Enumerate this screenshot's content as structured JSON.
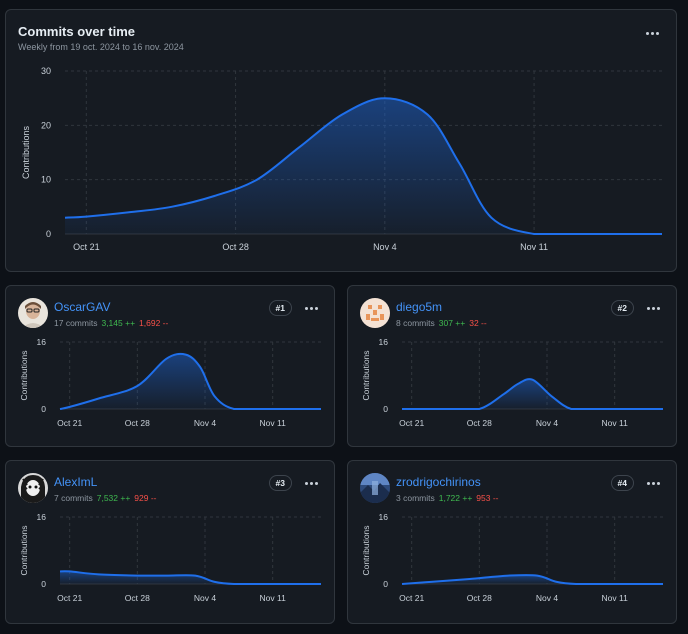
{
  "main": {
    "title": "Commits over time",
    "subtitle": "Weekly from 19 oct. 2024 to 16 nov. 2024"
  },
  "colors": {
    "background": "#0d1117",
    "panel": "#161b22",
    "border": "#30363d",
    "line": "#1f6feb",
    "grid": "#30363d",
    "link": "#4493f8",
    "additions": "#3fb950",
    "deletions": "#f85149"
  },
  "contributors": [
    {
      "rank": "#1",
      "name": "OscarGAV",
      "commits": "17 commits",
      "additions": "3,145 ++",
      "deletions": "1,692 --",
      "avatar": "avatar-photo"
    },
    {
      "rank": "#2",
      "name": "diego5m",
      "commits": "8 commits",
      "additions": "307 ++",
      "deletions": "32 --",
      "avatar": "avatar-identicon"
    },
    {
      "rank": "#3",
      "name": "AlexImL",
      "commits": "7 commits",
      "additions": "7,532 ++",
      "deletions": "929 --",
      "avatar": "avatar-photo"
    },
    {
      "rank": "#4",
      "name": "zrodrigochirinos",
      "commits": "3 commits",
      "additions": "1,722 ++",
      "deletions": "953 --",
      "avatar": "avatar-photo"
    }
  ],
  "chart_data": [
    {
      "type": "area",
      "title": "Commits over time",
      "ylabel": "Contributions",
      "xlabel": "",
      "x_ticks": [
        "Oct 21",
        "Oct 28",
        "Nov 4",
        "Nov 11"
      ],
      "yticks": [
        0,
        10,
        20,
        30
      ],
      "ylim": [
        0,
        30
      ],
      "xlim": [
        -1,
        27
      ],
      "grid": true,
      "x": [
        -1,
        0,
        2,
        4,
        6,
        8,
        10,
        12,
        14,
        16,
        17.5,
        19,
        21,
        23,
        25,
        27
      ],
      "values": [
        3,
        3.2,
        4,
        5,
        7,
        10,
        16,
        22,
        25,
        22,
        13,
        3,
        0,
        0,
        0,
        0
      ]
    },
    {
      "type": "area",
      "ylabel": "Contributions",
      "x_ticks": [
        "Oct 21",
        "Oct 28",
        "Nov 4",
        "Nov 11"
      ],
      "yticks": [
        0,
        16
      ],
      "ylim": [
        0,
        16
      ],
      "xlim": [
        -1,
        26
      ],
      "grid": true,
      "x": [
        -1,
        0,
        3,
        7,
        10,
        12,
        13.5,
        15,
        17,
        20,
        23,
        26
      ],
      "values": [
        0,
        0.5,
        2.5,
        5.5,
        12,
        13,
        10,
        3,
        0,
        0,
        0,
        0
      ]
    },
    {
      "type": "area",
      "ylabel": "Contributions",
      "x_ticks": [
        "Oct 21",
        "Oct 28",
        "Nov 4",
        "Nov 11"
      ],
      "yticks": [
        0,
        16
      ],
      "ylim": [
        0,
        16
      ],
      "xlim": [
        -1,
        26
      ],
      "grid": true,
      "x": [
        -1,
        4,
        7,
        9.5,
        11,
        12.5,
        14.5,
        16.5,
        19,
        23,
        26
      ],
      "values": [
        0,
        0,
        0,
        3.5,
        6,
        7,
        3,
        0,
        0,
        0,
        0
      ]
    },
    {
      "type": "area",
      "ylabel": "Contributions",
      "x_ticks": [
        "Oct 21",
        "Oct 28",
        "Nov 4",
        "Nov 11"
      ],
      "yticks": [
        0,
        16
      ],
      "ylim": [
        0,
        16
      ],
      "xlim": [
        -1,
        26
      ],
      "grid": true,
      "x": [
        -1,
        0,
        3,
        7,
        10,
        13,
        15,
        17,
        20,
        23,
        26
      ],
      "values": [
        3,
        3,
        2.3,
        2,
        2,
        2,
        0.5,
        0,
        0,
        0,
        0
      ]
    },
    {
      "type": "area",
      "ylabel": "Contributions",
      "x_ticks": [
        "Oct 21",
        "Oct 28",
        "Nov 4",
        "Nov 11"
      ],
      "yticks": [
        0,
        16
      ],
      "ylim": [
        0,
        16
      ],
      "xlim": [
        -1,
        26
      ],
      "grid": true,
      "x": [
        -1,
        2,
        6,
        10,
        13,
        15,
        17,
        20,
        23,
        26
      ],
      "values": [
        0,
        0.5,
        1.2,
        2,
        2,
        0.5,
        0,
        0,
        0,
        0
      ]
    }
  ]
}
